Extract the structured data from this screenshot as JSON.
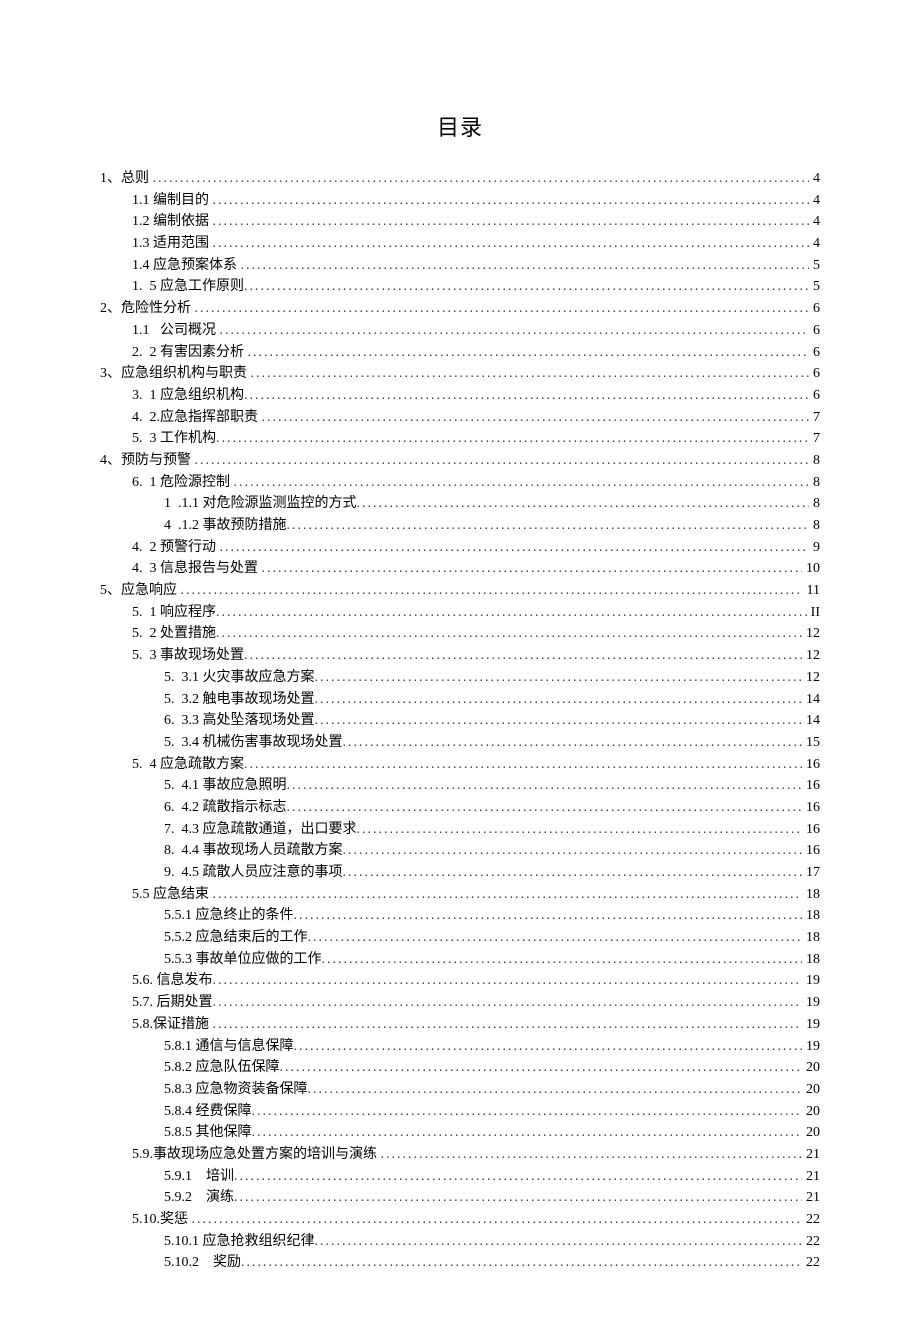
{
  "title": "目录",
  "toc": [
    {
      "lvl": 0,
      "text": "1、总则 ",
      "page": "4"
    },
    {
      "lvl": 1,
      "text": "1.1 编制目的 ",
      "page": "4"
    },
    {
      "lvl": 1,
      "text": "1.2 编制依据 ",
      "page": "4"
    },
    {
      "lvl": 1,
      "text": "1.3 适用范围 ",
      "page": "4"
    },
    {
      "lvl": 1,
      "text": "1.4 应急预案体系 ",
      "page": "5"
    },
    {
      "lvl": 1,
      "text": "1.  5 应急工作原则",
      "page": "5"
    },
    {
      "lvl": 0,
      "text": "2、危险性分析 ",
      "page": "6"
    },
    {
      "lvl": 1,
      "text": "1.1   公司概况 ",
      "page": "6"
    },
    {
      "lvl": 1,
      "text": "2.  2 有害因素分析 ",
      "page": "6"
    },
    {
      "lvl": 0,
      "text": "3、应急组织机构与职责 ",
      "page": "6"
    },
    {
      "lvl": 1,
      "text": "3.  1 应急组织机构",
      "page": "6"
    },
    {
      "lvl": 1,
      "text": "4.  2.应急指挥部职责 ",
      "page": "7"
    },
    {
      "lvl": 1,
      "text": "5.  3 工作机构",
      "page": "7"
    },
    {
      "lvl": 0,
      "text": "4、预防与预警 ",
      "page": "8"
    },
    {
      "lvl": 1,
      "text": "6.  1 危险源控制 ",
      "page": "8"
    },
    {
      "lvl": 2,
      "text": "1  .1.1 对危险源监测监控的方式",
      "page": "8"
    },
    {
      "lvl": 2,
      "text": "4  .1.2 事故预防措施",
      "page": "8"
    },
    {
      "lvl": 1,
      "text": "4.  2 预警行动 ",
      "page": "9"
    },
    {
      "lvl": 1,
      "text": "4.  3 信息报告与处置 ",
      "page": "10"
    },
    {
      "lvl": 0,
      "text": "5、应急响应 ",
      "page": "11"
    },
    {
      "lvl": 1,
      "text": "5.  1 响应程序",
      "page": "II"
    },
    {
      "lvl": 1,
      "text": "5.  2 处置措施",
      "page": "12"
    },
    {
      "lvl": 1,
      "text": "5.  3 事故现场处置",
      "page": "12"
    },
    {
      "lvl": 2,
      "text": "5.  3.1 火灾事故应急方案",
      "page": "12"
    },
    {
      "lvl": 2,
      "text": "5.  3.2 触电事故现场处置",
      "page": "14"
    },
    {
      "lvl": 2,
      "text": "6.  3.3 高处坠落现场处置",
      "page": "14"
    },
    {
      "lvl": 2,
      "text": "5.  3.4 机械伤害事故现场处置",
      "page": "15"
    },
    {
      "lvl": 1,
      "text": "5.  4 应急疏散方案",
      "page": "16"
    },
    {
      "lvl": 2,
      "text": "5.  4.1 事故应急照明",
      "page": "16"
    },
    {
      "lvl": 2,
      "text": "6.  4.2 疏散指示标志",
      "page": "16"
    },
    {
      "lvl": 2,
      "text": "7.  4.3 应急疏散通道，出口要求",
      "page": "16"
    },
    {
      "lvl": 2,
      "text": "8.  4.4 事故现场人员疏散方案",
      "page": "16"
    },
    {
      "lvl": 2,
      "text": "9.  4.5 疏散人员应注意的事项",
      "page": "17"
    },
    {
      "lvl": 1,
      "text": "5.5 应急结束 ",
      "page": "18"
    },
    {
      "lvl": 2,
      "text": "5.5.1 应急终止的条件",
      "page": "18"
    },
    {
      "lvl": 2,
      "text": "5.5.2 应急结束后的工作",
      "page": "18"
    },
    {
      "lvl": 2,
      "text": "5.5.3 事故单位应做的工作",
      "page": "18"
    },
    {
      "lvl": 1,
      "text": "5.6. 信息发布",
      "page": "19"
    },
    {
      "lvl": 1,
      "text": "5.7. 后期处置",
      "page": "19"
    },
    {
      "lvl": 1,
      "text": "5.8.保证措施 ",
      "page": "19"
    },
    {
      "lvl": 2,
      "text": "5.8.1 通信与信息保障",
      "page": "19"
    },
    {
      "lvl": 2,
      "text": "5.8.2 应急队伍保障",
      "page": "20"
    },
    {
      "lvl": 2,
      "text": "5.8.3 应急物资装备保障",
      "page": "20"
    },
    {
      "lvl": 2,
      "text": "5.8.4 经费保障",
      "page": "20"
    },
    {
      "lvl": 2,
      "text": "5.8.5 其他保障",
      "page": "20"
    },
    {
      "lvl": 1,
      "text": "5.9.事故现场应急处置方案的培训与演练 ",
      "page": "21"
    },
    {
      "lvl": 2,
      "text": "5.9.1    培训",
      "page": "21"
    },
    {
      "lvl": 2,
      "text": "5.9.2    演练",
      "page": "21"
    },
    {
      "lvl": 1,
      "text": "5.10.奖惩 ",
      "page": "22"
    },
    {
      "lvl": 2,
      "text": "5.10.1 应急抢救组织纪律",
      "page": "22"
    },
    {
      "lvl": 2,
      "text": "5.10.2    奖励",
      "page": "22"
    }
  ]
}
